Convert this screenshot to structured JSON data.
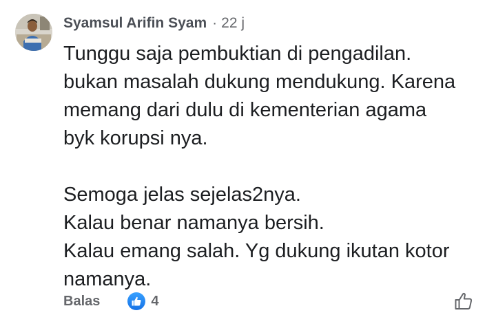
{
  "comment": {
    "author": "Syamsul Arifin Syam",
    "separator": "·",
    "timestamp": "22 j",
    "paragraphs": [
      {
        "lines": [
          "Tunggu saja pembuktian di pengadilan.",
          "bukan masalah dukung mendukung. Karena",
          "memang dari dulu di kementerian agama",
          "byk korupsi nya."
        ]
      },
      {
        "lines": [
          "Semoga jelas sejelas2nya.",
          "Kalau benar namanya bersih.",
          "Kalau emang salah. Yg dukung ikutan kotor",
          "namanya."
        ]
      }
    ]
  },
  "actions": {
    "reply_label": "Balas",
    "reaction_count": "4",
    "reaction_icon": "like-reaction-icon",
    "like_icon": "thumbs-up-outline-icon"
  },
  "colors": {
    "author": "#4b4f56",
    "meta": "#65676b",
    "text": "#1c1e21",
    "reaction_blue": "#1877f2"
  }
}
